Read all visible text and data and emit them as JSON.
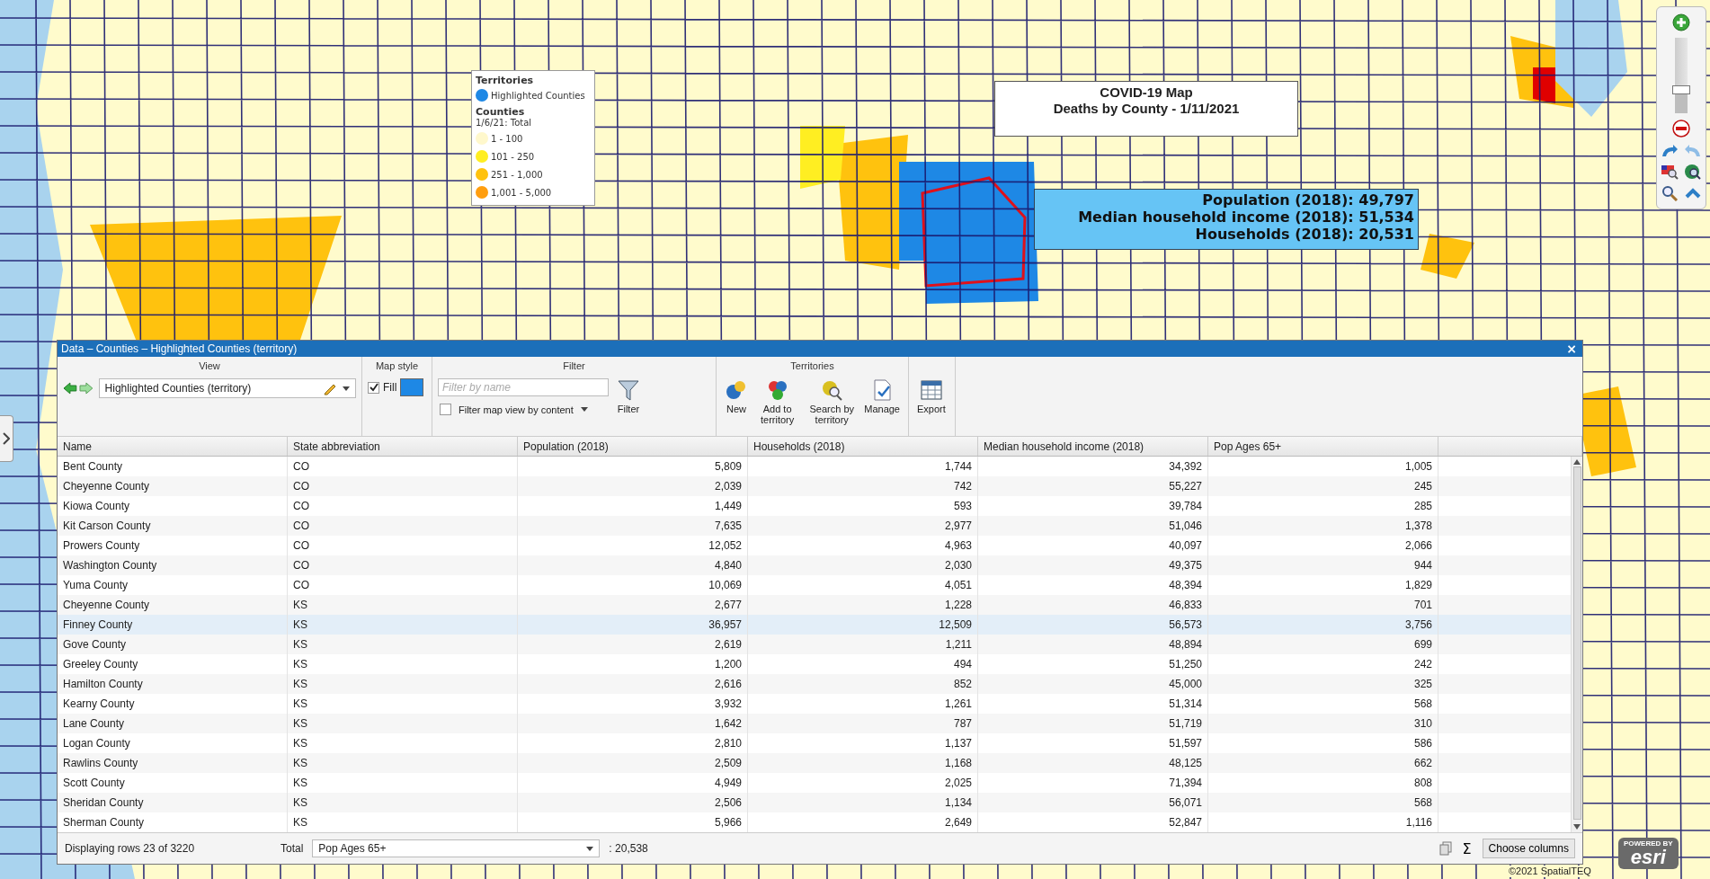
{
  "legend": {
    "sections": [
      {
        "title": "Territories",
        "items": [
          {
            "label": "Highlighted Counties",
            "color": "#1e88e5"
          }
        ]
      },
      {
        "title": "Counties",
        "subtitle": "1/6/21: Total",
        "items": [
          {
            "label": "1 - 100",
            "color": "#fff8cc"
          },
          {
            "label": "101 - 250",
            "color": "#ffee22"
          },
          {
            "label": "251 - 1,000",
            "color": "#ffc20e"
          },
          {
            "label": "1,001 - 5,000",
            "color": "#ff9e0f"
          }
        ]
      }
    ]
  },
  "map_title": {
    "lines": [
      "COVID-19 Map",
      "Deaths by County - 1/11/2021"
    ]
  },
  "info_callout": {
    "lines": [
      "Population (2018): 49,797",
      "Median household income (2018): 51,534",
      "Households (2018): 20,531"
    ]
  },
  "zoom_slider": {
    "level": 0.31
  },
  "data_panel": {
    "title": "Data – Counties – Highlighted Counties (territory)",
    "close": "×",
    "toolbar": {
      "view": {
        "label": "View",
        "value": "Highlighted Counties (territory)"
      },
      "map_style": {
        "label": "Map style",
        "fill_label": "Fill",
        "fill_checked": true
      },
      "filter": {
        "label": "Filter",
        "placeholder": "Filter by name",
        "map_view_label": "Filter map view by content",
        "map_view_checked": false,
        "button": "Filter"
      },
      "territories": {
        "label": "Territories",
        "buttons": [
          {
            "kind": "new",
            "label": "New"
          },
          {
            "kind": "add",
            "label": "Add to territory"
          },
          {
            "kind": "search",
            "label": "Search by territory"
          },
          {
            "kind": "manage",
            "label": "Manage"
          }
        ]
      },
      "export": "Export"
    },
    "table": {
      "columns": [
        {
          "label": "Name",
          "kind": "text"
        },
        {
          "label": "State abbreviation",
          "kind": "text"
        },
        {
          "label": "Population (2018)",
          "kind": "number"
        },
        {
          "label": "Households (2018)",
          "kind": "number"
        },
        {
          "label": "Median household income (2018)",
          "kind": "number"
        },
        {
          "label": "Pop Ages 65+",
          "kind": "number"
        }
      ],
      "rows": [
        {
          "cells": [
            "Bent County",
            "CO",
            "5,809",
            "1,744",
            "34,392",
            "1,005"
          ],
          "selected": false
        },
        {
          "cells": [
            "Cheyenne County",
            "CO",
            "2,039",
            "742",
            "55,227",
            "245"
          ],
          "selected": false
        },
        {
          "cells": [
            "Kiowa County",
            "CO",
            "1,449",
            "593",
            "39,784",
            "285"
          ],
          "selected": false
        },
        {
          "cells": [
            "Kit Carson County",
            "CO",
            "7,635",
            "2,977",
            "51,046",
            "1,378"
          ],
          "selected": false
        },
        {
          "cells": [
            "Prowers County",
            "CO",
            "12,052",
            "4,963",
            "40,097",
            "2,066"
          ],
          "selected": false
        },
        {
          "cells": [
            "Washington County",
            "CO",
            "4,840",
            "2,030",
            "49,375",
            "944"
          ],
          "selected": false
        },
        {
          "cells": [
            "Yuma County",
            "CO",
            "10,069",
            "4,051",
            "48,394",
            "1,829"
          ],
          "selected": false
        },
        {
          "cells": [
            "Cheyenne County",
            "KS",
            "2,677",
            "1,228",
            "46,833",
            "701"
          ],
          "selected": false
        },
        {
          "cells": [
            "Finney County",
            "KS",
            "36,957",
            "12,509",
            "56,573",
            "3,756"
          ],
          "selected": true
        },
        {
          "cells": [
            "Gove County",
            "KS",
            "2,619",
            "1,211",
            "48,894",
            "699"
          ],
          "selected": false
        },
        {
          "cells": [
            "Greeley County",
            "KS",
            "1,200",
            "494",
            "51,250",
            "242"
          ],
          "selected": false
        },
        {
          "cells": [
            "Hamilton County",
            "KS",
            "2,616",
            "852",
            "45,000",
            "325"
          ],
          "selected": false
        },
        {
          "cells": [
            "Kearny County",
            "KS",
            "3,932",
            "1,261",
            "51,314",
            "568"
          ],
          "selected": false
        },
        {
          "cells": [
            "Lane County",
            "KS",
            "1,642",
            "787",
            "51,719",
            "310"
          ],
          "selected": false
        },
        {
          "cells": [
            "Logan County",
            "KS",
            "2,810",
            "1,137",
            "51,597",
            "586"
          ],
          "selected": false
        },
        {
          "cells": [
            "Rawlins County",
            "KS",
            "2,509",
            "1,168",
            "48,125",
            "662"
          ],
          "selected": false
        },
        {
          "cells": [
            "Scott County",
            "KS",
            "4,949",
            "2,025",
            "71,394",
            "808"
          ],
          "selected": false
        },
        {
          "cells": [
            "Sheridan County",
            "KS",
            "2,506",
            "1,134",
            "56,071",
            "568"
          ],
          "selected": false
        },
        {
          "cells": [
            "Sherman County",
            "KS",
            "5,966",
            "2,649",
            "52,847",
            "1,116"
          ],
          "selected": false
        }
      ]
    },
    "footer": {
      "row_count": "Displaying rows 23 of 3220",
      "total_label": "Total",
      "total_field": "Pop Ages 65+",
      "total_value": ": 20,538",
      "sum_symbol": "Σ",
      "choose_columns": "Choose columns"
    }
  },
  "attribution": "©2021 SpatialTEQ",
  "logo": {
    "top": "POWERED BY",
    "name": "esri"
  }
}
